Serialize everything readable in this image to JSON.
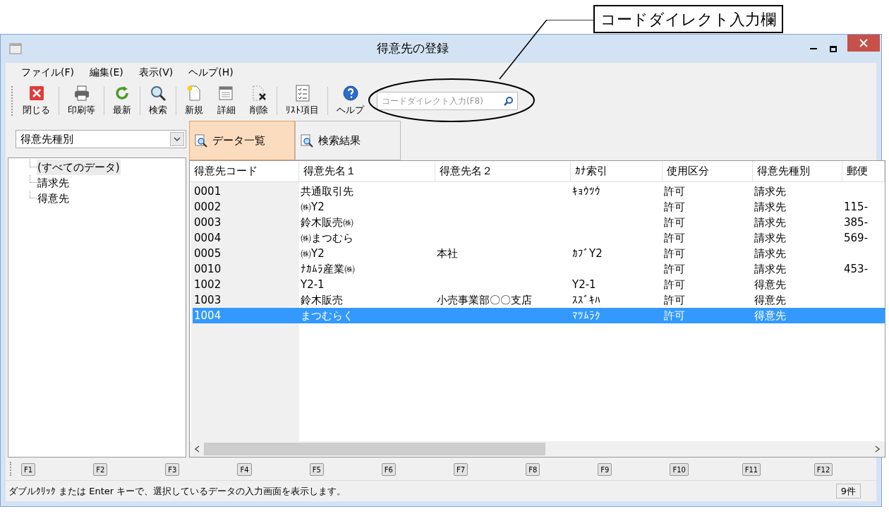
{
  "callout": {
    "text": "コードダイレクト入力欄"
  },
  "window": {
    "title": "得意先の登録"
  },
  "menu": [
    "ファイル(F)",
    "編集(E)",
    "表示(V)",
    "ヘルプ(H)"
  ],
  "toolbar": {
    "groups": [
      [
        "閉じる"
      ],
      [
        "印刷等"
      ],
      [
        "最新"
      ],
      [
        "検索"
      ],
      [
        "新規",
        "詳細",
        "削除"
      ],
      [
        "ﾘｽﾄ項目"
      ],
      [
        "ヘルプ"
      ]
    ],
    "search": {
      "placeholder": "コードダイレクト入力(F8)"
    }
  },
  "filter": {
    "value": "得意先種別"
  },
  "tree": [
    {
      "label": "(すべてのデータ)",
      "selected": true
    },
    {
      "label": "請求先",
      "selected": false
    },
    {
      "label": "得意先",
      "selected": false
    }
  ],
  "tabs": [
    {
      "label": "データ一覧",
      "selected": true
    },
    {
      "label": "検索結果",
      "selected": false
    }
  ],
  "table": {
    "columns": [
      "得意先コード",
      "得意先名１",
      "得意先名２",
      "ｶﾅ索引",
      "使用区分",
      "得意先種別",
      "郵便"
    ],
    "rows": [
      {
        "cells": [
          "0001",
          "共通取引先",
          "",
          "ｷｮｳﾂｳ",
          "許可",
          "請求先",
          ""
        ],
        "selected": false
      },
      {
        "cells": [
          "0002",
          "㈱Y2",
          "",
          "",
          "許可",
          "請求先",
          "115-"
        ],
        "selected": false
      },
      {
        "cells": [
          "0003",
          "鈴木販売㈱",
          "",
          "",
          "許可",
          "請求先",
          "385-"
        ],
        "selected": false
      },
      {
        "cells": [
          "0004",
          "㈱まつむら",
          "",
          "",
          "許可",
          "請求先",
          "569-"
        ],
        "selected": false
      },
      {
        "cells": [
          "0005",
          "㈱Y2",
          "本社",
          "ｶﾌﾞY2",
          "許可",
          "請求先",
          ""
        ],
        "selected": false
      },
      {
        "cells": [
          "0010",
          "ﾅｶﾑﾗ産業㈱",
          "",
          "",
          "許可",
          "請求先",
          "453-"
        ],
        "selected": false
      },
      {
        "cells": [
          "1002",
          "Y2-1",
          "",
          "Y2-1",
          "許可",
          "得意先",
          ""
        ],
        "selected": false
      },
      {
        "cells": [
          "1003",
          "鈴木販売",
          "小売事業部〇〇支店",
          "ｽｽﾞｷﾊ",
          "許可",
          "得意先",
          ""
        ],
        "selected": false
      },
      {
        "cells": [
          "1004",
          "まつむらく",
          "",
          "ﾏﾂﾑﾗｸ",
          "許可",
          "得意先",
          ""
        ],
        "selected": true
      }
    ]
  },
  "function_keys": [
    "F1",
    "F2",
    "F3",
    "F4",
    "F5",
    "F6",
    "F7",
    "F8",
    "F9",
    "F10",
    "F11",
    "F12"
  ],
  "status_bar": {
    "message": "ダブルｸﾘｯｸ または Enter キーで、選択しているデータの入力画面を表示します。",
    "count": "9件"
  }
}
